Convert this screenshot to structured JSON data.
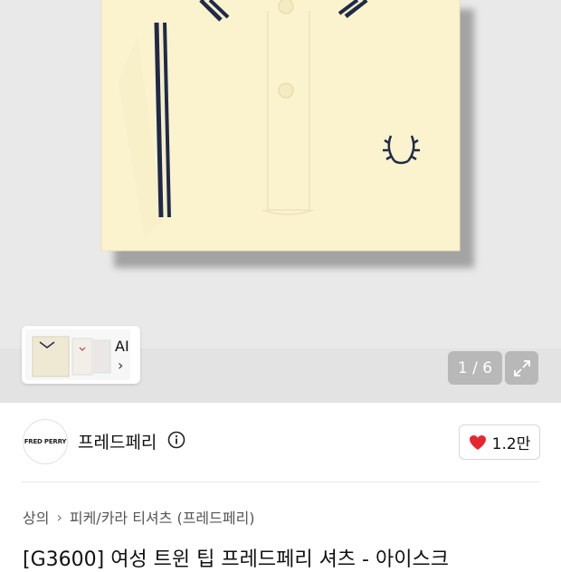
{
  "gallery": {
    "counter": "1 / 6",
    "ai_label": "AI",
    "ai_chevron": "›",
    "expand_icon": "expand-icon"
  },
  "brand": {
    "logo_text": "FRED PERRY",
    "name": "프레드페리",
    "likes": "1.2만",
    "heart_color": "#e5282f"
  },
  "breadcrumb": {
    "level1": "상의",
    "sep": "›",
    "level2": "피케/카라 티셔츠 (프레드페리)"
  },
  "product": {
    "title": "[G3600] 여성 트윈 팁 프레드페리 셔츠 - 아이스크"
  },
  "colors": {
    "shirt": "#fbf3cd",
    "tipping": "#1f2a4a",
    "gallery_bg": "#e9e9e9"
  }
}
